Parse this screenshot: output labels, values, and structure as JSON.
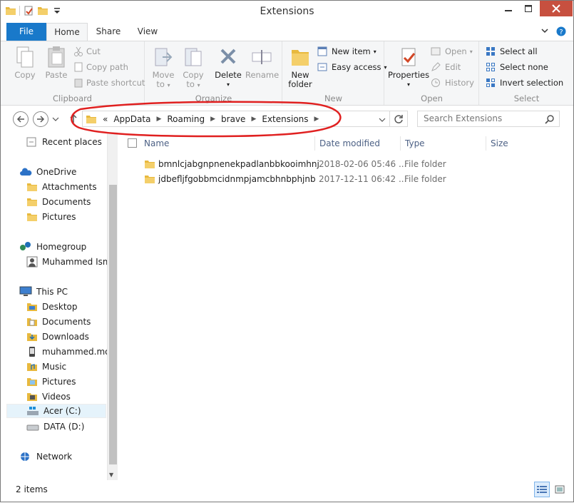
{
  "window": {
    "title": "Extensions"
  },
  "tabs": {
    "file": "File",
    "home": "Home",
    "share": "Share",
    "view": "View"
  },
  "ribbon": {
    "clipboard": {
      "label": "Clipboard",
      "copy": "Copy",
      "paste": "Paste",
      "cut": "Cut",
      "copy_path": "Copy path",
      "paste_shortcut": "Paste shortcut"
    },
    "organize": {
      "label": "Organize",
      "move_to_1": "Move",
      "move_to_2": "to",
      "copy_to_1": "Copy",
      "copy_to_2": "to",
      "delete": "Delete",
      "rename": "Rename"
    },
    "new": {
      "label": "New",
      "new_folder_1": "New",
      "new_folder_2": "folder",
      "new_item": "New item",
      "easy_access": "Easy access"
    },
    "open": {
      "label": "Open",
      "properties": "Properties",
      "open": "Open",
      "edit": "Edit",
      "history": "History"
    },
    "select": {
      "label": "Select",
      "select_all": "Select all",
      "select_none": "Select none",
      "invert_selection": "Invert selection"
    }
  },
  "address": {
    "overflow": "«",
    "breadcrumbs": [
      "AppData",
      "Roaming",
      "brave",
      "Extensions"
    ],
    "search_placeholder": "Search Extensions"
  },
  "nav": {
    "items": [
      {
        "label": "Recent places"
      },
      {
        "label": "OneDrive"
      },
      {
        "label": "Attachments"
      },
      {
        "label": "Documents"
      },
      {
        "label": "Pictures"
      },
      {
        "label": "Homegroup"
      },
      {
        "label": "Muhammed Ism"
      },
      {
        "label": "This PC"
      },
      {
        "label": "Desktop"
      },
      {
        "label": "Documents"
      },
      {
        "label": "Downloads"
      },
      {
        "label": "muhammed.mo"
      },
      {
        "label": "Music"
      },
      {
        "label": "Pictures"
      },
      {
        "label": "Videos"
      },
      {
        "label": "Acer (C:)"
      },
      {
        "label": "DATA (D:)"
      },
      {
        "label": "Network"
      }
    ]
  },
  "columns": {
    "name": "Name",
    "date": "Date modified",
    "type": "Type",
    "size": "Size"
  },
  "files": [
    {
      "name": "bmnlcjabgnpnenekpadlanbbkooimhnj",
      "date": "2018-02-06 05:46 ...",
      "type": "File folder"
    },
    {
      "name": "jdbefljfgobbmcidnmpjamcbhnbphjnb",
      "date": "2017-12-11 06:42 ...",
      "type": "File folder"
    }
  ],
  "status": {
    "count": "2 items"
  },
  "colors": {
    "accent": "#1979ca",
    "folder": "#e8b93e",
    "annotation": "#e02020"
  }
}
